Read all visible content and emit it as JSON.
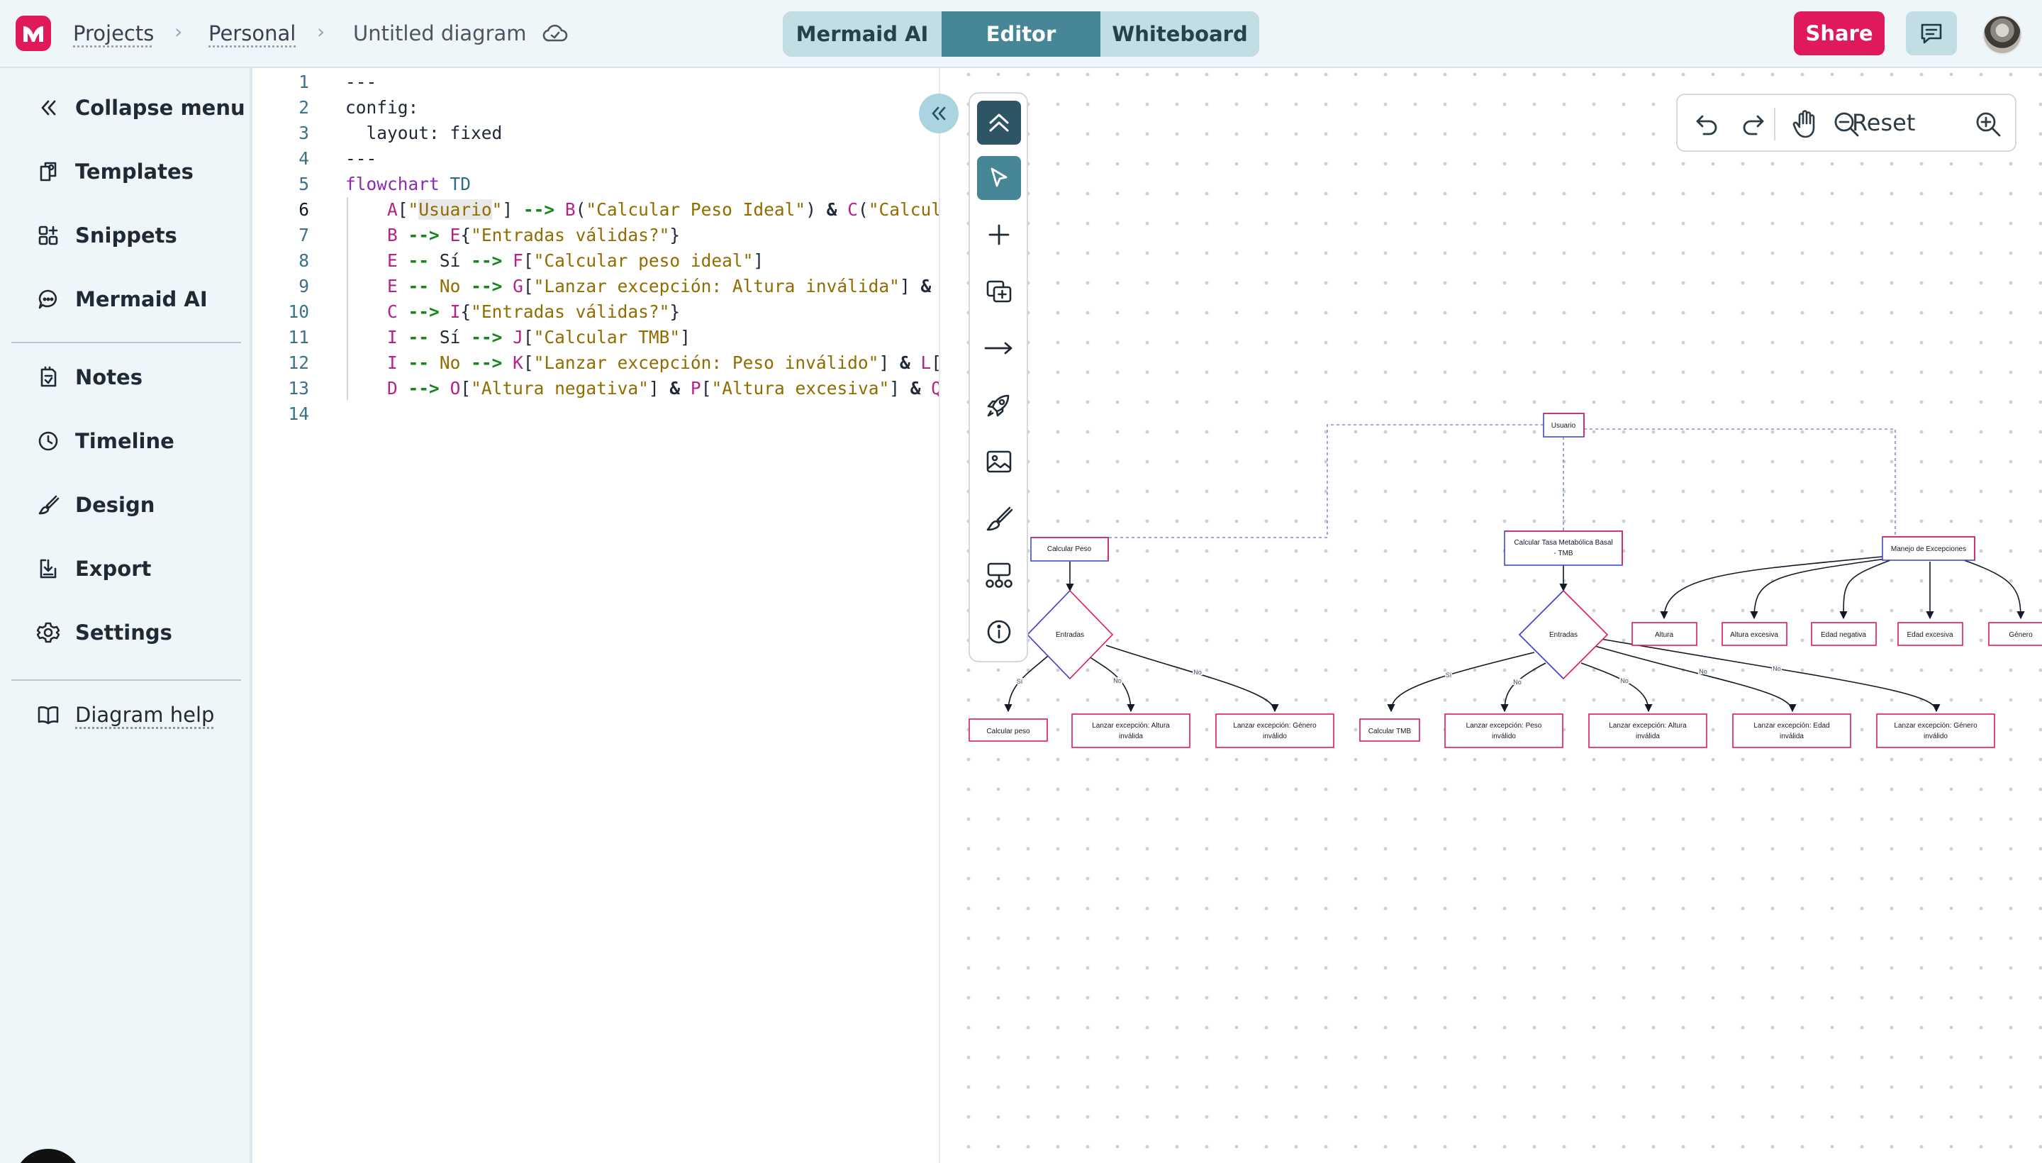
{
  "header": {
    "breadcrumbs": [
      "Projects",
      "Personal"
    ],
    "separator": "›",
    "document_title": "Untitled diagram",
    "mode_tabs": [
      "Mermaid AI",
      "Editor",
      "Whiteboard"
    ],
    "active_tab": "Editor",
    "share_label": "Share",
    "brand_color": "#e0195b",
    "accent_color": "#468697"
  },
  "sidebar": {
    "items": [
      {
        "label": "Collapse menu",
        "icon": "double-chevron-left-icon"
      },
      {
        "label": "Templates",
        "icon": "templates-icon"
      },
      {
        "label": "Snippets",
        "icon": "snippets-icon"
      },
      {
        "label": "Mermaid AI",
        "icon": "chat-bubble-icon"
      },
      {
        "label": "Notes",
        "icon": "notes-icon"
      },
      {
        "label": "Timeline",
        "icon": "clock-icon"
      },
      {
        "label": "Design",
        "icon": "brush-icon"
      },
      {
        "label": "Export",
        "icon": "export-icon"
      },
      {
        "label": "Settings",
        "icon": "gear-icon"
      }
    ],
    "help_label": "Diagram help"
  },
  "editor": {
    "line_numbers": [
      "1",
      "2",
      "3",
      "4",
      "5",
      "6",
      "7",
      "8",
      "9",
      "10",
      "11",
      "12",
      "13",
      "14"
    ],
    "active_line": "6",
    "lines": [
      "---",
      "config:",
      "  layout: fixed",
      "---",
      "flowchart TD",
      "    A[\"Usuario\"] --> B(\"Calcular Peso Ideal\") & C(\"Calcula",
      "    B --> E{\"Entradas válidas?\"}",
      "    E -- Sí --> F[\"Calcular peso ideal\"]",
      "    E -- No --> G[\"Lanzar excepción: Altura inválida\"] & H",
      "    C --> I{\"Entradas válidas?\"}",
      "    I -- Sí --> J[\"Calcular TMB\"]",
      "    I -- No --> K[\"Lanzar excepción: Peso inválido\"] & L[\"",
      "    D --> O[\"Altura negativa\"] & P[\"Altura excesiva\"] & Q[",
      ""
    ]
  },
  "toolbar": {
    "tools": [
      "chevron-up-icon",
      "pointer-icon",
      "plus-icon",
      "add-frame-icon",
      "arrow-right-icon",
      "rocket-icon",
      "image-icon",
      "brush-icon",
      "shapes-icon",
      "info-icon"
    ],
    "active_tool": "pointer-icon"
  },
  "zoom": {
    "reset_label": "Reset"
  },
  "diagram": {
    "nodes": {
      "usuario": "Usuario",
      "calc_peso": "Calcular Peso",
      "calc_tmb_1": "Calcular Tasa Metabólica Basal",
      "calc_tmb_2": "- TMB",
      "manejo": "Manejo de Excepciones",
      "entradas_1": "Entradas",
      "entradas_2": "Entradas",
      "calcular_peso": "Calcular peso",
      "exc_altura_1_a": "Lanzar excepción: Altura",
      "exc_altura_1_b": "inválida",
      "exc_genero_1_a": "Lanzar excepción: Género",
      "exc_genero_1_b": "inválido",
      "calcular_tmb": "Calcular TMB",
      "exc_peso_a": "Lanzar excepción: Peso",
      "exc_peso_b": "inválido",
      "exc_altura_2_a": "Lanzar excepción: Altura",
      "exc_altura_2_b": "inválida",
      "exc_edad_a": "Lanzar excepción: Edad",
      "exc_edad_b": "inválida",
      "exc_genero_2_a": "Lanzar excepción: Género",
      "exc_genero_2_b": "inválido",
      "altura": "Altura",
      "altura_excesiva": "Altura excesiva",
      "edad_negativa": "Edad negativa",
      "edad_excesiva": "Edad excesiva",
      "genero": "Género"
    },
    "edge_labels": {
      "si": "Sí",
      "no": "No"
    },
    "node_border_color": "#e0195b",
    "node_accent_color": "#3b4bd8"
  }
}
